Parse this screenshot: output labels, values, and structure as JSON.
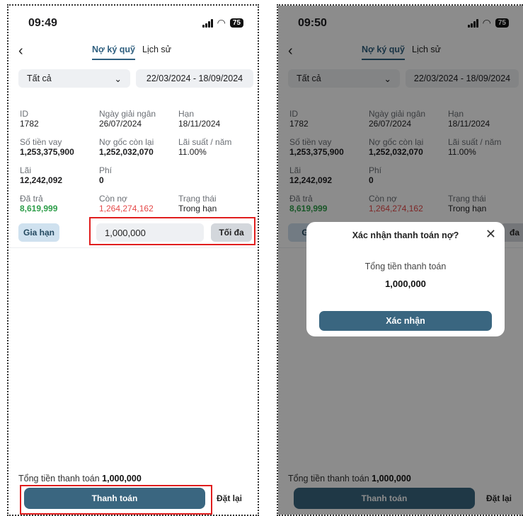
{
  "screens": [
    {
      "time": "09:49",
      "battery": "75",
      "tabs": [
        "Nợ ký quỹ",
        "Lịch sử"
      ],
      "filter": "Tất cả",
      "date_range": "22/03/2024 - 18/09/2024",
      "loan": {
        "id_label": "ID",
        "id": "1782",
        "disbursed_label": "Ngày giải ngân",
        "disbursed": "26/07/2024",
        "due_label": "Hạn",
        "due": "18/11/2024",
        "principal_label": "Số tiền vay",
        "principal": "1,253,375,900",
        "remaining_label": "Nợ gốc còn lại",
        "remaining": "1,252,032,070",
        "rate_label": "Lãi suất / năm",
        "rate": "11.00%",
        "interest_label": "Lãi",
        "interest": "12,242,092",
        "fee_label": "Phí",
        "fee": "0",
        "paid_label": "Đã trả",
        "paid": "8,619,999",
        "owed_label": "Còn nợ",
        "owed": "1,264,274,162",
        "status_label": "Trạng thái",
        "status": "Trong hạn"
      },
      "extend_button": "Gia hạn",
      "amount_input": "1,000,000",
      "max_button": "Tối đa",
      "total_label": "Tổng tiền thanh toán",
      "total_value": "1,000,000",
      "pay_button": "Thanh toán",
      "reset_button": "Đặt lại"
    },
    {
      "time": "09:50",
      "battery": "75",
      "tabs": [
        "Nợ ký quỹ",
        "Lịch sử"
      ],
      "filter": "Tất cả",
      "date_range": "22/03/2024 - 18/09/2024",
      "loan": {
        "id_label": "ID",
        "id": "1782",
        "disbursed_label": "Ngày giải ngân",
        "disbursed": "26/07/2024",
        "due_label": "Hạn",
        "due": "18/11/2024",
        "principal_label": "Số tiền vay",
        "principal": "1,253,375,900",
        "remaining_label": "Nợ gốc còn lại",
        "remaining": "1,252,032,070",
        "rate_label": "Lãi suất / năm",
        "rate": "11.00%",
        "interest_label": "Lãi",
        "interest": "12,242,092",
        "fee_label": "Phí",
        "fee": "0",
        "paid_label": "Đã trả",
        "paid": "8,619,999",
        "owed_label": "Còn nợ",
        "owed": "1,264,274,162",
        "status_label": "Trạng thái",
        "status": "Trong hạn"
      },
      "extend_button_partial": "Gia",
      "max_button_partial": "đa",
      "total_label": "Tổng tiền thanh toán",
      "total_value": "1,000,000",
      "pay_button": "Thanh toán",
      "reset_button": "Đặt lại",
      "modal": {
        "title": "Xác nhận thanh toán nợ?",
        "label": "Tổng tiền thanh toán",
        "value": "1,000,000",
        "confirm": "Xác nhận"
      }
    }
  ],
  "colors": {
    "primary": "#3a6680",
    "accent_tab": "#2f5f7f",
    "paid_green": "#2e9e4a",
    "owed_red": "#e54848",
    "highlight_red": "#e01e1e"
  }
}
